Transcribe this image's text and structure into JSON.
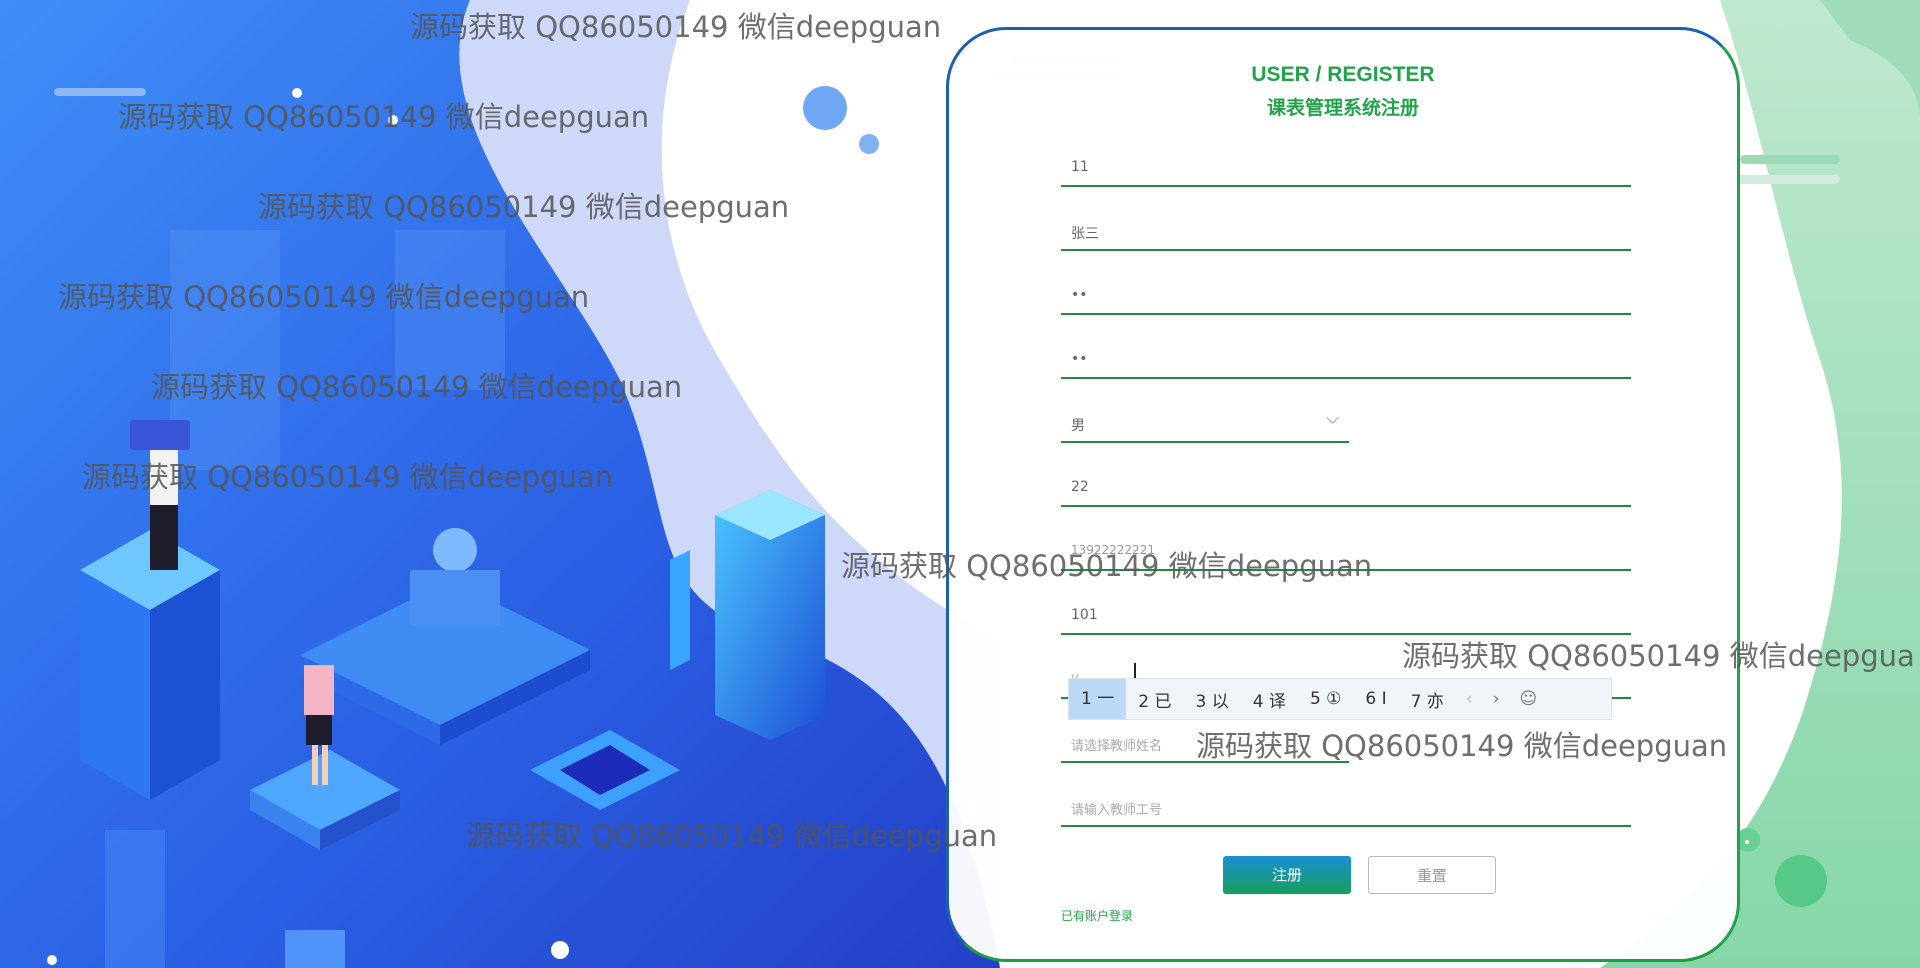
{
  "form": {
    "title_en": "USER / REGISTER",
    "title_cn": "课表管理系统注册",
    "fields": [
      {
        "value": "11",
        "placeholder": ""
      },
      {
        "value": "张三",
        "placeholder": ""
      },
      {
        "value": "••",
        "placeholder": ""
      },
      {
        "value": "••",
        "placeholder": ""
      },
      {
        "value": "男",
        "placeholder": ""
      },
      {
        "value": "22",
        "placeholder": ""
      },
      {
        "value": "13922222221",
        "placeholder": ""
      },
      {
        "value": "101",
        "placeholder": ""
      },
      {
        "value": "y",
        "placeholder": ""
      },
      {
        "value": "",
        "placeholder": "请选择教师姓名"
      },
      {
        "value": "",
        "placeholder": "请输入教师工号"
      }
    ],
    "register_label": "注册",
    "reset_label": "重置",
    "login_link": "已有账户登录"
  },
  "ime": {
    "candidates": [
      "1 一",
      "2 已",
      "3 以",
      "4 译",
      "5 ①",
      "6 Ⅰ",
      "7 亦"
    ],
    "prev_icon": "chevron-left-icon",
    "next_icon": "chevron-right-icon",
    "emoji_icon": "smiley-icon",
    "emoji_glyph": "☺"
  },
  "watermark": "源码获取 QQ86050149 微信deepguan",
  "watermark_cut": "源码获取 QQ86050149 微信deepgua",
  "colors": {
    "accent_green": "#22a34b",
    "field_line": "#1c8d3e",
    "bg_blue": "#2a63e8"
  }
}
